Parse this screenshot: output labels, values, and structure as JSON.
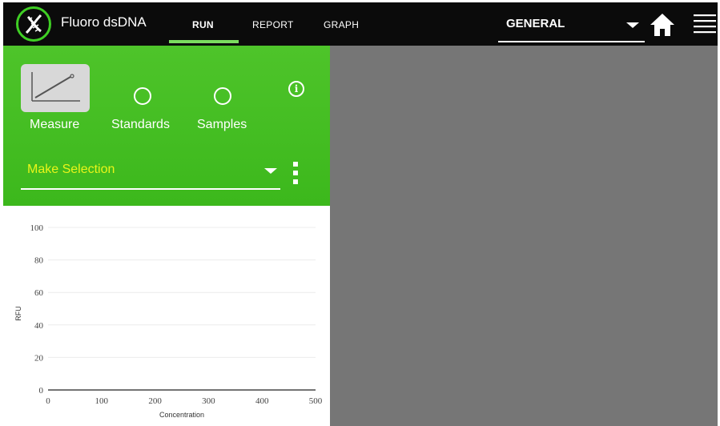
{
  "app": {
    "title": "Fluoro dsDNA"
  },
  "tabs": [
    {
      "label": "RUN",
      "active": true
    },
    {
      "label": "REPORT",
      "active": false
    },
    {
      "label": "GRAPH",
      "active": false
    }
  ],
  "project": {
    "value": "GENERAL"
  },
  "steps": [
    {
      "label": "Measure",
      "icon": "standard-curve-icon",
      "selected": true
    },
    {
      "label": "Standards",
      "icon": "circle-icon",
      "selected": false
    },
    {
      "label": "Samples",
      "icon": "circle-icon",
      "selected": false
    }
  ],
  "info": {
    "glyph": "i"
  },
  "selection": {
    "value": "Make Selection"
  },
  "colors": {
    "topbar": "#0b0b0b",
    "panel_green": "#43bd22",
    "accent_green": "#7bdc5f",
    "selection_text": "#e9f51a",
    "right_pane": "#767676"
  },
  "chart_data": {
    "type": "scatter",
    "xlabel": "Concentration",
    "ylabel": "RFU",
    "xlim": [
      0,
      500
    ],
    "ylim": [
      0,
      100
    ],
    "x_ticks": [
      "0",
      "100",
      "200",
      "300",
      "400",
      "500"
    ],
    "y_ticks": [
      "0",
      "20",
      "40",
      "60",
      "80",
      "100"
    ],
    "series": [],
    "grid": true
  }
}
